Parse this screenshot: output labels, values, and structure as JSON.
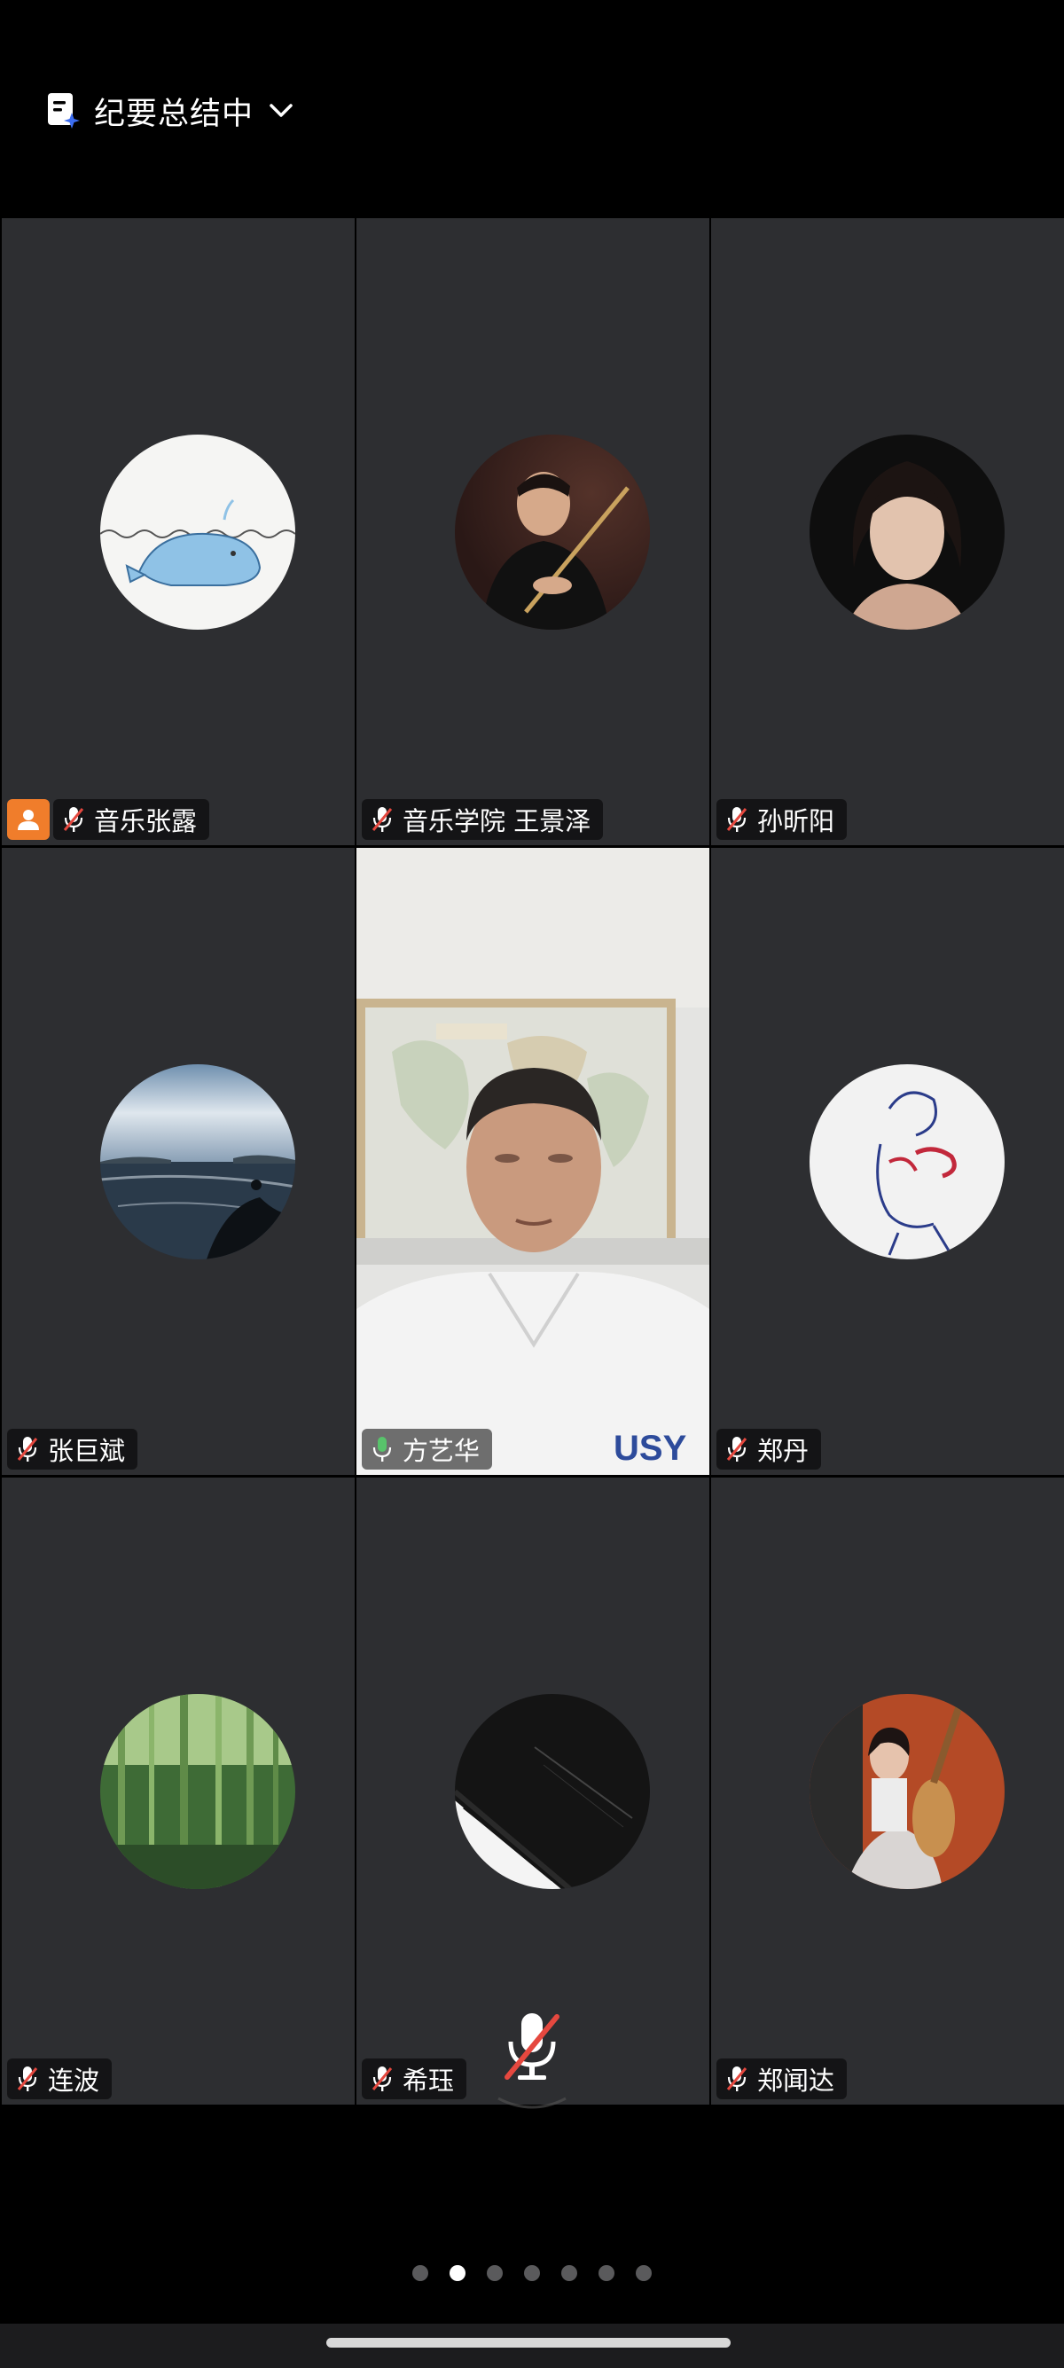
{
  "header": {
    "summary_label": "纪要总结中"
  },
  "participants": [
    {
      "name": "音乐张露"
    },
    {
      "name": "音乐学院 王景泽"
    },
    {
      "name": "孙昕阳"
    },
    {
      "name": "张巨斌"
    },
    {
      "name": "方艺华"
    },
    {
      "name": "郑丹"
    },
    {
      "name": "连波"
    },
    {
      "name": "希珏"
    },
    {
      "name": "郑闻达"
    }
  ],
  "pager": {
    "count": 7,
    "active": 2
  },
  "colors": {
    "tile_bg": "#2d2e31",
    "active_border": "#58c36b",
    "host_badge": "#f07d2b",
    "muted_red": "#e5483f",
    "mic_green": "#58c36b"
  },
  "icons": {
    "summary": "ai-document-icon",
    "expand": "chevron-down-icon",
    "mic_off": "mic-off-icon",
    "mic_on": "mic-on-icon",
    "host": "host-person-icon"
  }
}
